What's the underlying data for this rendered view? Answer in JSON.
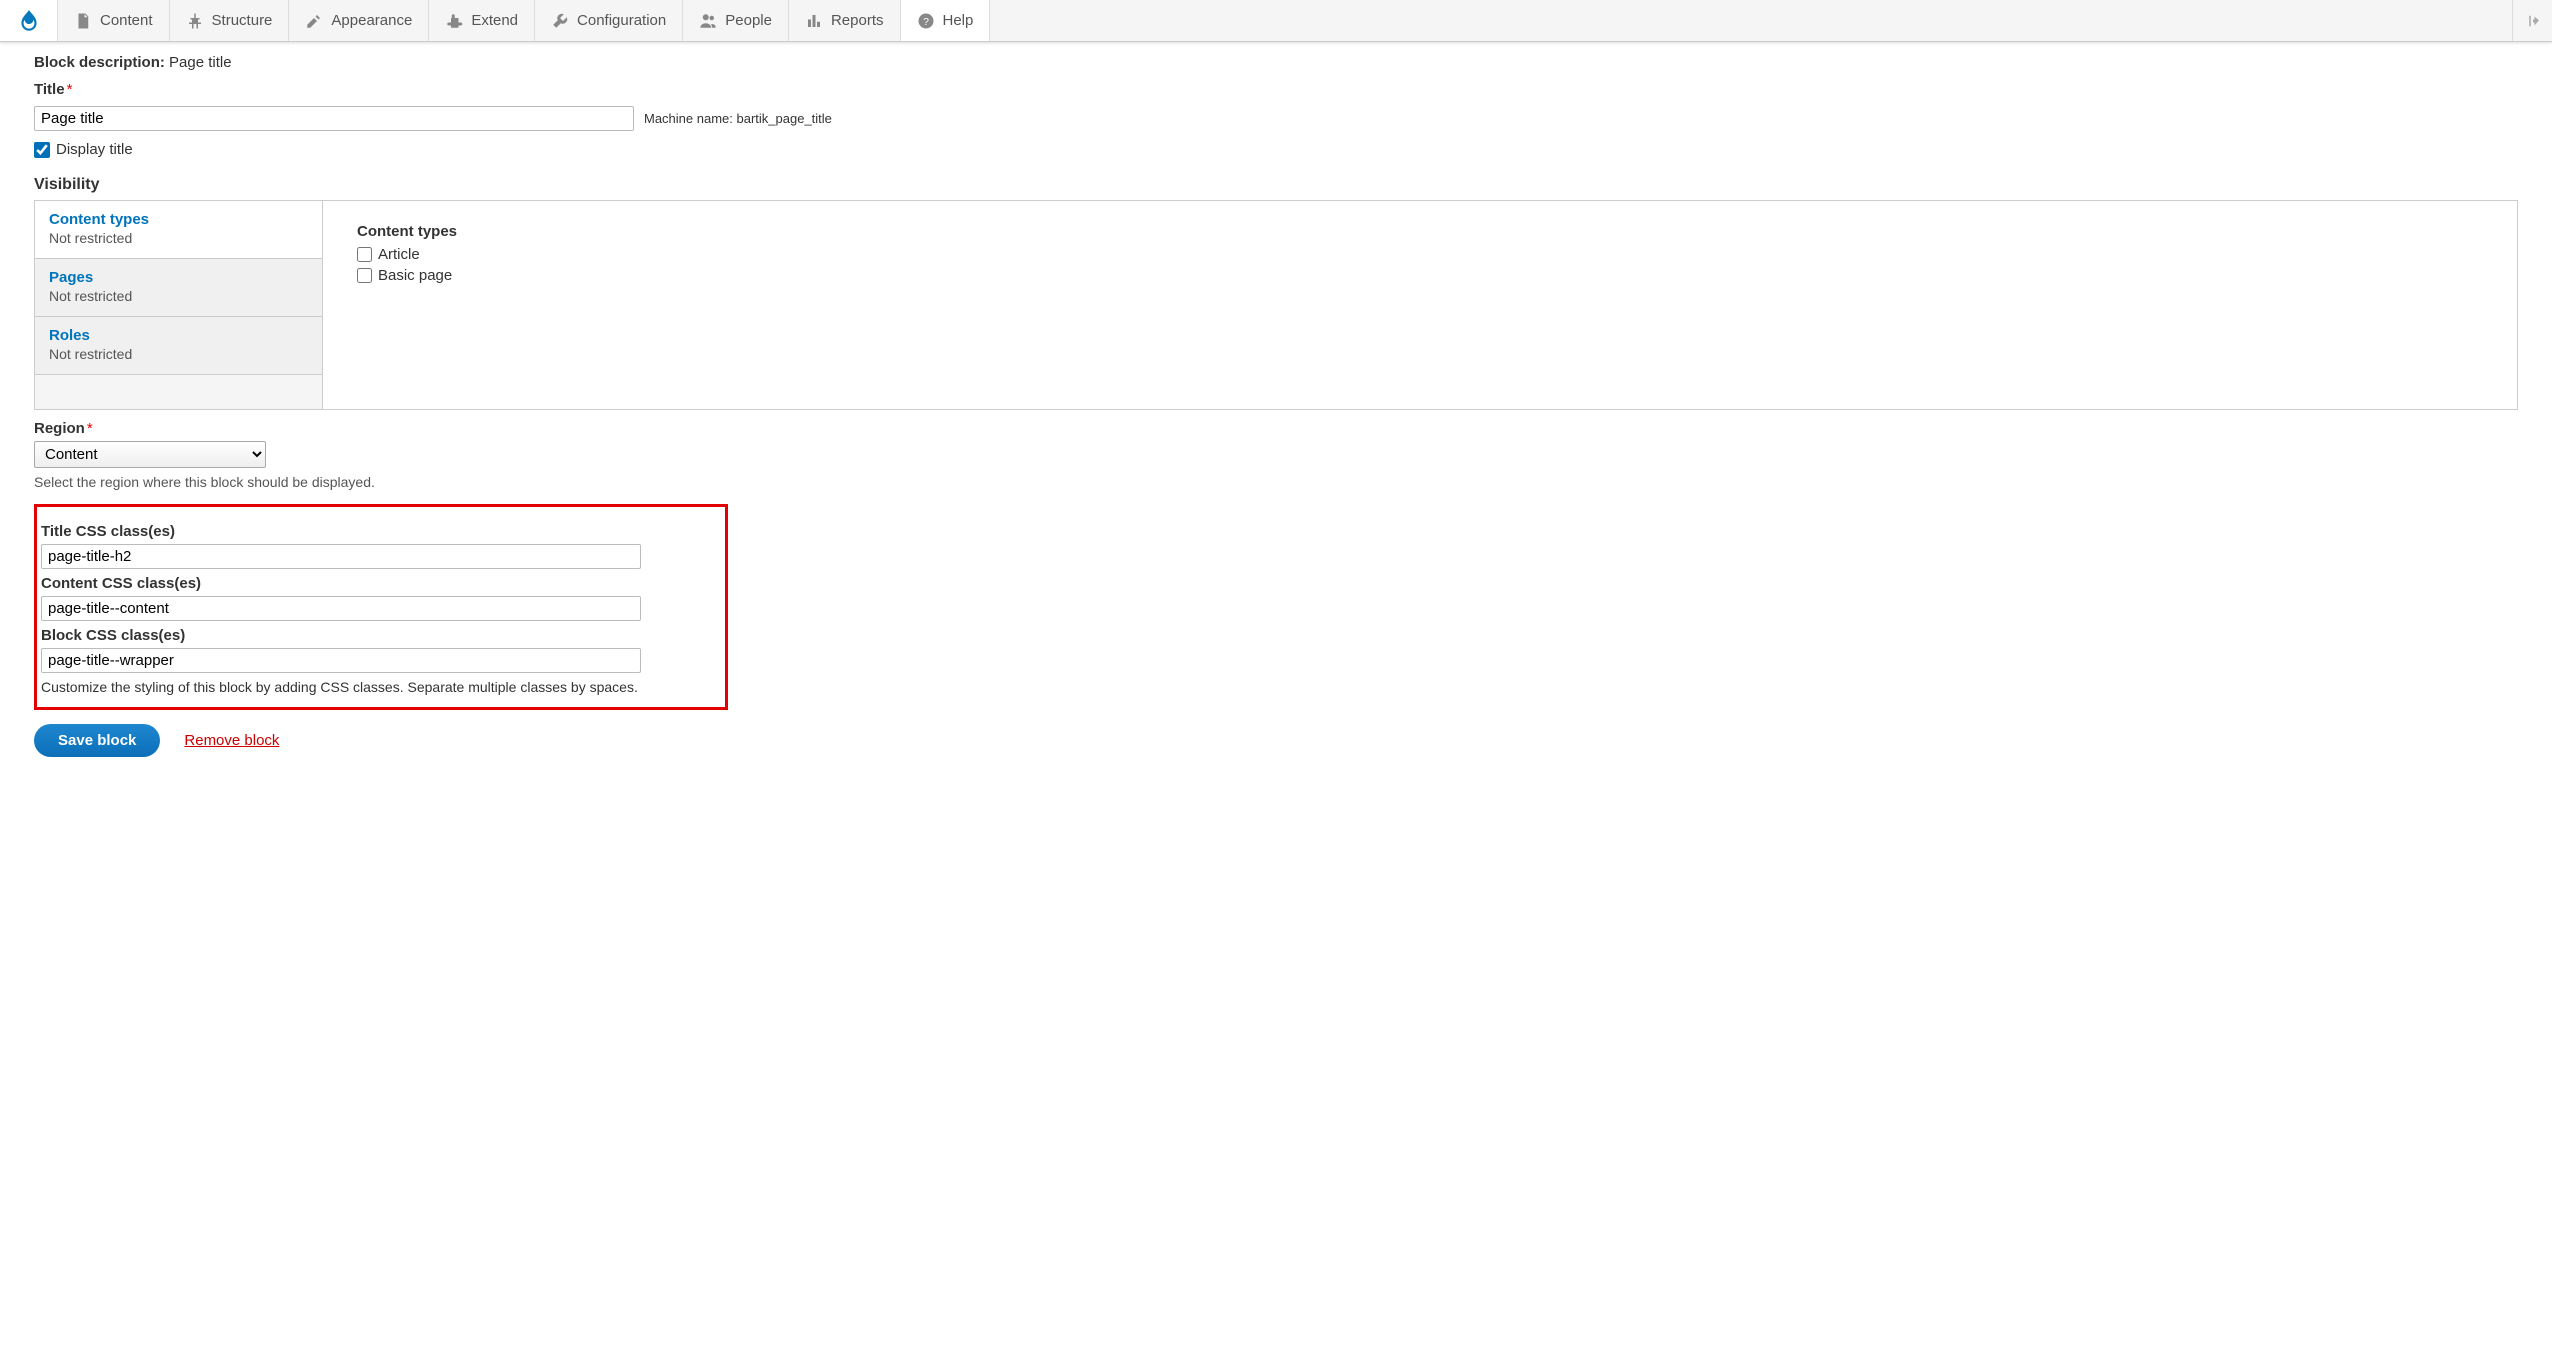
{
  "toolbar": {
    "items": [
      {
        "label": "Content"
      },
      {
        "label": "Structure"
      },
      {
        "label": "Appearance"
      },
      {
        "label": "Extend"
      },
      {
        "label": "Configuration"
      },
      {
        "label": "People"
      },
      {
        "label": "Reports"
      },
      {
        "label": "Help"
      }
    ]
  },
  "block_description": {
    "label": "Block description:",
    "value": "Page title"
  },
  "title_field": {
    "label": "Title",
    "value": "Page title"
  },
  "machine_name": {
    "label": "Machine name:",
    "value": "bartik_page_title"
  },
  "display_title": {
    "label": "Display title"
  },
  "visibility": {
    "heading": "Visibility",
    "tabs": [
      {
        "title": "Content types",
        "summary": "Not restricted"
      },
      {
        "title": "Pages",
        "summary": "Not restricted"
      },
      {
        "title": "Roles",
        "summary": "Not restricted"
      }
    ],
    "pane": {
      "title": "Content types",
      "options": [
        "Article",
        "Basic page"
      ]
    }
  },
  "region": {
    "label": "Region",
    "value": "Content",
    "description": "Select the region where this block should be displayed."
  },
  "css_classes": {
    "title": {
      "label": "Title CSS class(es)",
      "value": "page-title-h2"
    },
    "content": {
      "label": "Content CSS class(es)",
      "value": "page-title--content"
    },
    "block": {
      "label": "Block CSS class(es)",
      "value": "page-title--wrapper"
    },
    "description": "Customize the styling of this block by adding CSS classes. Separate multiple classes by spaces."
  },
  "actions": {
    "save": "Save block",
    "remove": "Remove block"
  }
}
